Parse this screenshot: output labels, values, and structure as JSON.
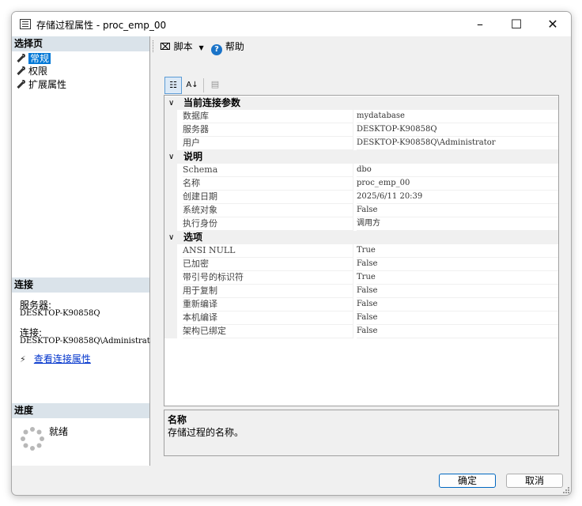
{
  "window": {
    "title": "存储过程属性 - proc_emp_00"
  },
  "sidebar": {
    "select_page_header": "选择页",
    "pages": [
      {
        "label": "常规",
        "selected": true
      },
      {
        "label": "权限",
        "selected": false
      },
      {
        "label": "扩展属性",
        "selected": false
      }
    ],
    "connection_header": "连接",
    "server_label": "服务器:",
    "server_value": "DESKTOP-K90858Q",
    "connection_label": "连接:",
    "connection_value": "DESKTOP-K90858Q\\Administrat",
    "view_connection_link": "查看连接属性",
    "progress_header": "进度",
    "progress_status": "就绪"
  },
  "toolbar": {
    "script_label": "脚本",
    "help_label": "帮助"
  },
  "property_grid": {
    "categories": [
      {
        "name": "当前连接参数",
        "rows": [
          {
            "name": "数据库",
            "value": "mydatabase"
          },
          {
            "name": "服务器",
            "value": "DESKTOP-K90858Q"
          },
          {
            "name": "用户",
            "value": "DESKTOP-K90858Q\\Administrator"
          }
        ]
      },
      {
        "name": "说明",
        "rows": [
          {
            "name": "Schema",
            "value": "dbo"
          },
          {
            "name": "名称",
            "value": "proc_emp_00"
          },
          {
            "name": "创建日期",
            "value": "2025/6/11 20:39"
          },
          {
            "name": "系统对象",
            "value": "False"
          },
          {
            "name": "执行身份",
            "value": "调用方"
          }
        ]
      },
      {
        "name": "选项",
        "rows": [
          {
            "name": "ANSI NULL",
            "value": "True"
          },
          {
            "name": "已加密",
            "value": "False"
          },
          {
            "name": "带引号的标识符",
            "value": "True"
          },
          {
            "name": "用于复制",
            "value": "False"
          },
          {
            "name": "重新编译",
            "value": "False"
          },
          {
            "name": "本机编译",
            "value": "False"
          },
          {
            "name": "架构已绑定",
            "value": "False"
          }
        ]
      }
    ]
  },
  "description": {
    "title": "名称",
    "text": "存储过程的名称。"
  },
  "buttons": {
    "ok": "确定",
    "cancel": "取消"
  },
  "colors": {
    "accent": "#0078d7",
    "section_header": "#dae3ea",
    "link": "#0033cc"
  }
}
